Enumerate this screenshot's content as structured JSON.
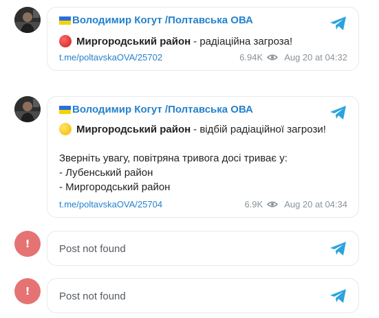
{
  "posts": [
    {
      "author": "Володимир Когут /Полтавська ОВА",
      "status_emoji": "red-circle",
      "highlight": "Миргородський район",
      "rest": "- радіаційна загроза!",
      "link": "t.me/poltavskaOVA/25702",
      "views": "6.94K",
      "date": "Aug 20 at 04:32"
    },
    {
      "author": "Володимир Когут /Полтавська ОВА",
      "status_emoji": "yellow-circle",
      "highlight": "Миргородський район",
      "rest": "- відбій радіаційної загрози!",
      "lines": [
        "Зверніть увагу, повітряна тривога досі триває у:",
        "- Лубенський район",
        "- Миргородський район"
      ],
      "link": "t.me/poltavskaOVA/25704",
      "views": "6.9K",
      "date": "Aug 20 at 04:34"
    }
  ],
  "errors": [
    {
      "badge": "!",
      "message": "Post not found"
    },
    {
      "badge": "!",
      "message": "Post not found"
    }
  ],
  "colors": {
    "accent": "#2481cc",
    "error_badge": "#e57373",
    "meta": "#8a9299",
    "border": "#e4e8ec"
  }
}
